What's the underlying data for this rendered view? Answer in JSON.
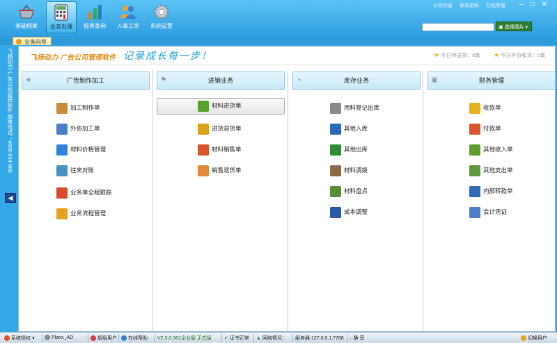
{
  "nav": [
    {
      "label": "基础档案",
      "icon": "basket-icon"
    },
    {
      "label": "业务处理",
      "icon": "calculator-icon",
      "active": true
    },
    {
      "label": "报表查询",
      "icon": "bar-chart-icon"
    },
    {
      "label": "人事工资",
      "icon": "people-icon"
    },
    {
      "label": "系统设置",
      "icon": "gear-icon"
    }
  ],
  "top_links": [
    "公司信息",
    "修改密码",
    "在线客服"
  ],
  "search": {
    "value": "",
    "placeholder": ""
  },
  "select_image_label": "选择图片",
  "tab_label": "业务向导",
  "side_text": "飞扬动力-广告公司管理软件   服务电话：4008-654-888",
  "banner": {
    "brand": "飞扬动力-广告公司管理软件",
    "slogan": "记录成长每一步！",
    "notice1": "今日待送货：0笔",
    "notice2": "今日外协收货：0笔"
  },
  "columns": [
    {
      "title": "广告制作加工",
      "icon": "star-icon",
      "items": [
        {
          "label": "加工制作单",
          "icon": "clipboard-icon",
          "color": "#c98a3a"
        },
        {
          "label": "外协加工单",
          "icon": "document-icon",
          "color": "#4a7fc8"
        },
        {
          "label": "材料价格管理",
          "icon": "price-icon",
          "color": "#2f86d6"
        },
        {
          "label": "往来对账",
          "icon": "magnifier-icon",
          "color": "#4a90c0"
        },
        {
          "label": "业务单全程跟踪",
          "icon": "clock-icon",
          "color": "#d9492b"
        },
        {
          "label": "业务流程管理",
          "icon": "flow-icon",
          "color": "#e6a21c"
        }
      ]
    },
    {
      "title": "进销业务",
      "icon": "flag-icon",
      "items": [
        {
          "label": "材料进货单",
          "icon": "basket-icon",
          "color": "#5aa02c",
          "highlight": true
        },
        {
          "label": "进货退货单",
          "icon": "basket-yellow-icon",
          "color": "#d9a21c"
        },
        {
          "label": "材料销售单",
          "icon": "cards-icon",
          "color": "#d9542b"
        },
        {
          "label": "销售退货单",
          "icon": "cards-orange-icon",
          "color": "#e08a3a"
        }
      ]
    },
    {
      "title": "库存业务",
      "icon": "box-icon",
      "items": [
        {
          "label": "用料登记出库",
          "icon": "notebook-icon",
          "color": "#8a8a8a"
        },
        {
          "label": "其他入库",
          "icon": "cart-in-icon",
          "color": "#2a6ab8"
        },
        {
          "label": "其他出库",
          "icon": "cart-out-icon",
          "color": "#2f8a3a"
        },
        {
          "label": "材料调拨",
          "icon": "boxes-icon",
          "color": "#8a6a4a"
        },
        {
          "label": "材料盘点",
          "icon": "inventory-icon",
          "color": "#5a8a3a"
        },
        {
          "label": "成本调整",
          "icon": "wand-icon",
          "color": "#2a5aa8"
        }
      ]
    },
    {
      "title": "财务管理",
      "icon": "money-icon",
      "items": [
        {
          "label": "收款单",
          "icon": "coins-icon",
          "color": "#e6b21c"
        },
        {
          "label": "付款单",
          "icon": "payment-icon",
          "color": "#d9542b"
        },
        {
          "label": "其他收入单",
          "icon": "cash-in-icon",
          "color": "#5aa02c"
        },
        {
          "label": "其他支出单",
          "icon": "cash-out-icon",
          "color": "#5a9a3a"
        },
        {
          "label": "内部转款单",
          "icon": "transfer-icon",
          "color": "#2f6ab8"
        },
        {
          "label": "会计凭证",
          "icon": "voucher-icon",
          "color": "#4a7fc8"
        }
      ]
    }
  ],
  "status": {
    "auth": "系统授权",
    "user": "Planx_AD",
    "role": "超级用户",
    "help": "在线帮助",
    "version": "V2.3.0.361企业版 正式版",
    "cert": "证书正常",
    "network": "网络情况：",
    "server": "服务器:127.0.0.1:7788",
    "sound": "静 音",
    "switch_user": "切换用户"
  }
}
